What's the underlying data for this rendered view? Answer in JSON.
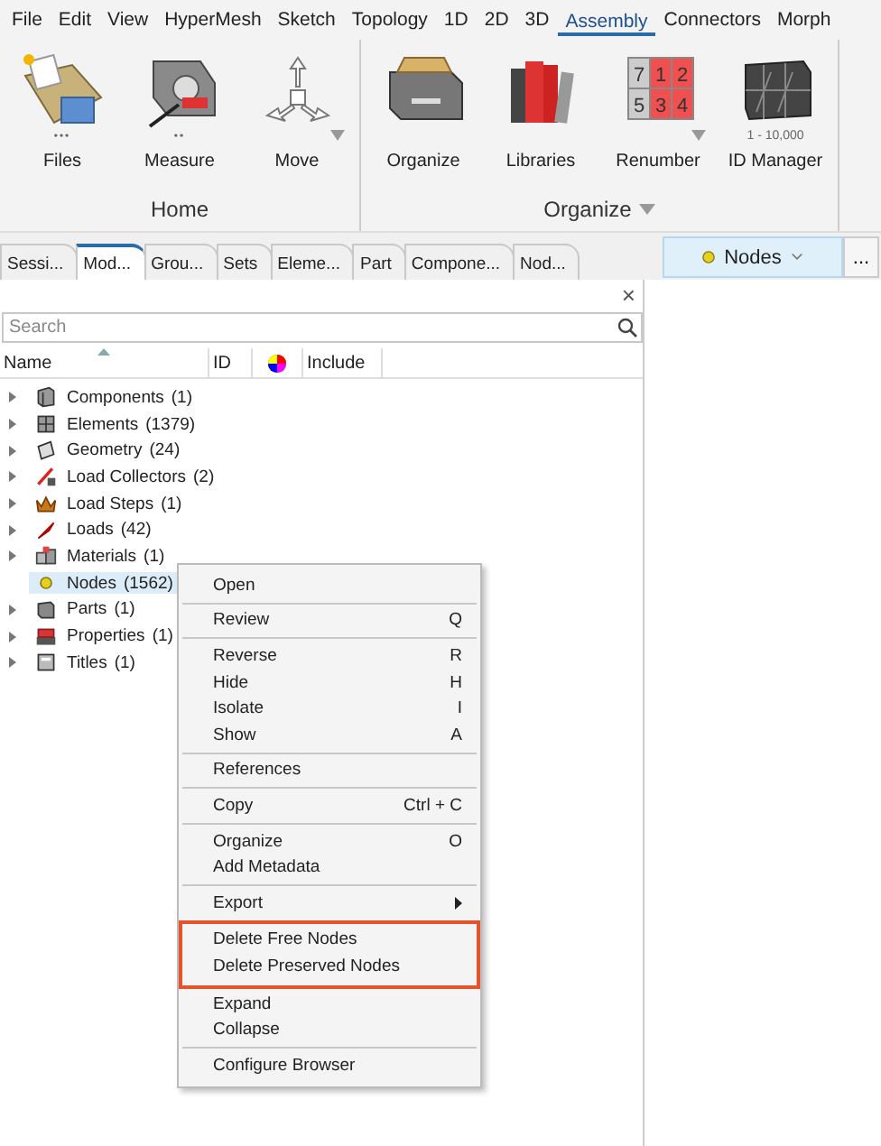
{
  "menu_bar": [
    {
      "label": "File",
      "selected": false
    },
    {
      "label": "Edit",
      "selected": false
    },
    {
      "label": "View",
      "selected": false
    },
    {
      "label": "HyperMesh",
      "selected": false
    },
    {
      "label": "Sketch",
      "selected": false
    },
    {
      "label": "Topology",
      "selected": false
    },
    {
      "label": "1D",
      "selected": false
    },
    {
      "label": "2D",
      "selected": false
    },
    {
      "label": "3D",
      "selected": false
    },
    {
      "label": "Assembly",
      "selected": true
    },
    {
      "label": "Connectors",
      "selected": false
    },
    {
      "label": "Morph",
      "selected": false
    }
  ],
  "ribbon": {
    "groups": [
      {
        "label": "Home",
        "has_dropdown": false,
        "tools": [
          {
            "label": "Files",
            "dots": "•••",
            "has_dropdown": false
          },
          {
            "label": "Measure",
            "dots": "••",
            "has_dropdown": false
          },
          {
            "label": "Move",
            "has_dropdown": true
          }
        ]
      },
      {
        "label": "Organize",
        "has_dropdown": true,
        "tools": [
          {
            "label": "Organize",
            "has_dropdown": false
          },
          {
            "label": "Libraries",
            "has_dropdown": false
          },
          {
            "label": "Renumber",
            "has_dropdown": true,
            "tiles": [
              "7",
              "1",
              "2",
              "5",
              "3",
              "4"
            ]
          },
          {
            "label": "ID Manager",
            "caption": "1 - 10,000",
            "has_dropdown": false
          }
        ]
      }
    ]
  },
  "browser_tabs": [
    {
      "label": "Sessi...",
      "selected": false
    },
    {
      "label": "Mod...",
      "selected": true
    },
    {
      "label": "Grou...",
      "selected": false
    },
    {
      "label": "Sets",
      "selected": false
    },
    {
      "label": "Eleme...",
      "selected": false
    },
    {
      "label": "Part",
      "selected": false
    },
    {
      "label": "Compone...",
      "selected": false
    },
    {
      "label": "Nod...",
      "selected": false
    }
  ],
  "entity_selector": {
    "label": "Nodes",
    "more": "..."
  },
  "close": "×",
  "search": {
    "placeholder": "Search"
  },
  "tree": {
    "columns": [
      {
        "label": "Name",
        "sorted": true
      },
      {
        "label": "ID",
        "sorted": false
      },
      {
        "kind": "color",
        "sorted": false
      },
      {
        "label": "Include",
        "sorted": false
      }
    ],
    "rows": [
      {
        "name": "Components",
        "count": "(1)",
        "expandable": true,
        "selected": false
      },
      {
        "name": "Elements",
        "count": "(1379)",
        "expandable": true,
        "selected": false
      },
      {
        "name": "Geometry",
        "count": "(24)",
        "expandable": true,
        "selected": false
      },
      {
        "name": "Load Collectors",
        "count": "(2)",
        "expandable": true,
        "selected": false
      },
      {
        "name": "Load Steps",
        "count": "(1)",
        "expandable": true,
        "selected": false
      },
      {
        "name": "Loads",
        "count": "(42)",
        "expandable": true,
        "selected": false
      },
      {
        "name": "Materials",
        "count": "(1)",
        "expandable": true,
        "selected": false
      },
      {
        "name": "Nodes",
        "count": "(1562)",
        "expandable": false,
        "selected": true
      },
      {
        "name": "Parts",
        "count": "(1)",
        "expandable": true,
        "selected": false
      },
      {
        "name": "Properties",
        "count": "(1)",
        "expandable": true,
        "selected": false
      },
      {
        "name": "Titles",
        "count": "(1)",
        "expandable": true,
        "selected": false
      }
    ]
  },
  "context_menu": {
    "sections": [
      {
        "highlighted": false,
        "items": [
          {
            "label": "Open"
          }
        ]
      },
      {
        "highlighted": false,
        "items": [
          {
            "label": "Review",
            "shortcut": "Q"
          }
        ]
      },
      {
        "highlighted": false,
        "items": [
          {
            "label": "Reverse",
            "shortcut": "R"
          },
          {
            "label": "Hide",
            "shortcut": "H"
          },
          {
            "label": "Isolate",
            "shortcut": "I"
          },
          {
            "label": "Show",
            "shortcut": "A"
          }
        ]
      },
      {
        "highlighted": false,
        "items": [
          {
            "label": "References"
          }
        ]
      },
      {
        "highlighted": false,
        "items": [
          {
            "label": "Copy",
            "shortcut": "Ctrl + C"
          }
        ]
      },
      {
        "highlighted": false,
        "items": [
          {
            "label": "Organize",
            "shortcut": "O"
          },
          {
            "label": "Add Metadata"
          }
        ]
      },
      {
        "highlighted": false,
        "items": [
          {
            "label": "Export",
            "submenu": true
          }
        ]
      },
      {
        "highlighted": true,
        "items": [
          {
            "label": "Delete Free Nodes"
          },
          {
            "label": "Delete Preserved Nodes"
          }
        ]
      },
      {
        "highlighted": false,
        "items": [
          {
            "label": "Expand"
          },
          {
            "label": "Collapse"
          }
        ]
      },
      {
        "highlighted": false,
        "items": [
          {
            "label": "Configure Browser"
          }
        ]
      }
    ]
  }
}
